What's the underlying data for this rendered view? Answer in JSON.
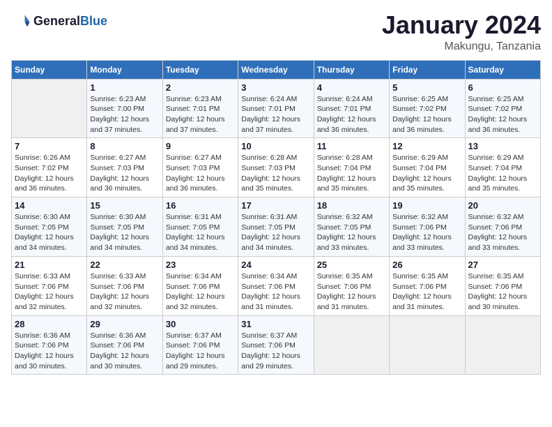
{
  "header": {
    "logo_general": "General",
    "logo_blue": "Blue",
    "title": "January 2024",
    "subtitle": "Makungu, Tanzania"
  },
  "calendar": {
    "days_of_week": [
      "Sunday",
      "Monday",
      "Tuesday",
      "Wednesday",
      "Thursday",
      "Friday",
      "Saturday"
    ],
    "weeks": [
      [
        {
          "day": "",
          "info": ""
        },
        {
          "day": "1",
          "info": "Sunrise: 6:23 AM\nSunset: 7:00 PM\nDaylight: 12 hours\nand 37 minutes."
        },
        {
          "day": "2",
          "info": "Sunrise: 6:23 AM\nSunset: 7:01 PM\nDaylight: 12 hours\nand 37 minutes."
        },
        {
          "day": "3",
          "info": "Sunrise: 6:24 AM\nSunset: 7:01 PM\nDaylight: 12 hours\nand 37 minutes."
        },
        {
          "day": "4",
          "info": "Sunrise: 6:24 AM\nSunset: 7:01 PM\nDaylight: 12 hours\nand 36 minutes."
        },
        {
          "day": "5",
          "info": "Sunrise: 6:25 AM\nSunset: 7:02 PM\nDaylight: 12 hours\nand 36 minutes."
        },
        {
          "day": "6",
          "info": "Sunrise: 6:25 AM\nSunset: 7:02 PM\nDaylight: 12 hours\nand 36 minutes."
        }
      ],
      [
        {
          "day": "7",
          "info": "Sunrise: 6:26 AM\nSunset: 7:02 PM\nDaylight: 12 hours\nand 36 minutes."
        },
        {
          "day": "8",
          "info": "Sunrise: 6:27 AM\nSunset: 7:03 PM\nDaylight: 12 hours\nand 36 minutes."
        },
        {
          "day": "9",
          "info": "Sunrise: 6:27 AM\nSunset: 7:03 PM\nDaylight: 12 hours\nand 36 minutes."
        },
        {
          "day": "10",
          "info": "Sunrise: 6:28 AM\nSunset: 7:03 PM\nDaylight: 12 hours\nand 35 minutes."
        },
        {
          "day": "11",
          "info": "Sunrise: 6:28 AM\nSunset: 7:04 PM\nDaylight: 12 hours\nand 35 minutes."
        },
        {
          "day": "12",
          "info": "Sunrise: 6:29 AM\nSunset: 7:04 PM\nDaylight: 12 hours\nand 35 minutes."
        },
        {
          "day": "13",
          "info": "Sunrise: 6:29 AM\nSunset: 7:04 PM\nDaylight: 12 hours\nand 35 minutes."
        }
      ],
      [
        {
          "day": "14",
          "info": "Sunrise: 6:30 AM\nSunset: 7:05 PM\nDaylight: 12 hours\nand 34 minutes."
        },
        {
          "day": "15",
          "info": "Sunrise: 6:30 AM\nSunset: 7:05 PM\nDaylight: 12 hours\nand 34 minutes."
        },
        {
          "day": "16",
          "info": "Sunrise: 6:31 AM\nSunset: 7:05 PM\nDaylight: 12 hours\nand 34 minutes."
        },
        {
          "day": "17",
          "info": "Sunrise: 6:31 AM\nSunset: 7:05 PM\nDaylight: 12 hours\nand 34 minutes."
        },
        {
          "day": "18",
          "info": "Sunrise: 6:32 AM\nSunset: 7:05 PM\nDaylight: 12 hours\nand 33 minutes."
        },
        {
          "day": "19",
          "info": "Sunrise: 6:32 AM\nSunset: 7:06 PM\nDaylight: 12 hours\nand 33 minutes."
        },
        {
          "day": "20",
          "info": "Sunrise: 6:32 AM\nSunset: 7:06 PM\nDaylight: 12 hours\nand 33 minutes."
        }
      ],
      [
        {
          "day": "21",
          "info": "Sunrise: 6:33 AM\nSunset: 7:06 PM\nDaylight: 12 hours\nand 32 minutes."
        },
        {
          "day": "22",
          "info": "Sunrise: 6:33 AM\nSunset: 7:06 PM\nDaylight: 12 hours\nand 32 minutes."
        },
        {
          "day": "23",
          "info": "Sunrise: 6:34 AM\nSunset: 7:06 PM\nDaylight: 12 hours\nand 32 minutes."
        },
        {
          "day": "24",
          "info": "Sunrise: 6:34 AM\nSunset: 7:06 PM\nDaylight: 12 hours\nand 31 minutes."
        },
        {
          "day": "25",
          "info": "Sunrise: 6:35 AM\nSunset: 7:06 PM\nDaylight: 12 hours\nand 31 minutes."
        },
        {
          "day": "26",
          "info": "Sunrise: 6:35 AM\nSunset: 7:06 PM\nDaylight: 12 hours\nand 31 minutes."
        },
        {
          "day": "27",
          "info": "Sunrise: 6:35 AM\nSunset: 7:06 PM\nDaylight: 12 hours\nand 30 minutes."
        }
      ],
      [
        {
          "day": "28",
          "info": "Sunrise: 6:36 AM\nSunset: 7:06 PM\nDaylight: 12 hours\nand 30 minutes."
        },
        {
          "day": "29",
          "info": "Sunrise: 6:36 AM\nSunset: 7:06 PM\nDaylight: 12 hours\nand 30 minutes."
        },
        {
          "day": "30",
          "info": "Sunrise: 6:37 AM\nSunset: 7:06 PM\nDaylight: 12 hours\nand 29 minutes."
        },
        {
          "day": "31",
          "info": "Sunrise: 6:37 AM\nSunset: 7:06 PM\nDaylight: 12 hours\nand 29 minutes."
        },
        {
          "day": "",
          "info": ""
        },
        {
          "day": "",
          "info": ""
        },
        {
          "day": "",
          "info": ""
        }
      ]
    ]
  }
}
